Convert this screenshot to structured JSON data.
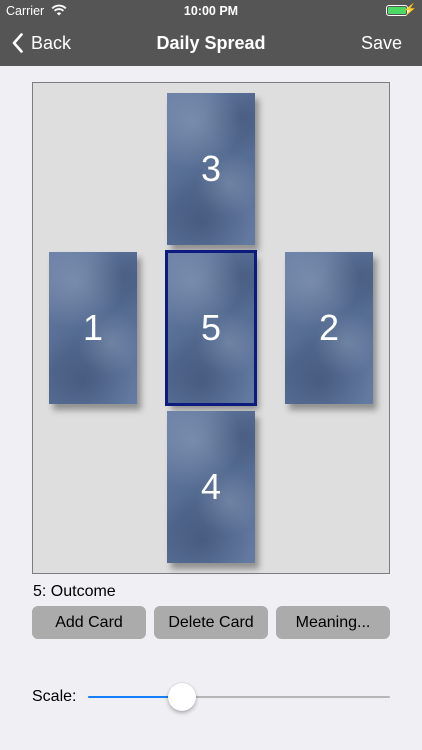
{
  "status_bar": {
    "carrier": "Carrier",
    "time": "10:00 PM"
  },
  "nav": {
    "back_label": "Back",
    "title": "Daily Spread",
    "save_label": "Save"
  },
  "spread": {
    "cards": [
      {
        "number": "3"
      },
      {
        "number": "1"
      },
      {
        "number": "5",
        "selected": true
      },
      {
        "number": "2"
      },
      {
        "number": "4"
      }
    ]
  },
  "selected_caption": "5: Outcome",
  "buttons": {
    "add": "Add Card",
    "delete": "Delete Card",
    "meaning": "Meaning..."
  },
  "scale": {
    "label": "Scale:",
    "value_fraction": 0.31
  },
  "colors": {
    "nav_bar": "#555555",
    "card_back": "#5b7197",
    "selected_outline": "#0d1b7e",
    "slider_accent": "#147efb",
    "button": "#ababab"
  }
}
